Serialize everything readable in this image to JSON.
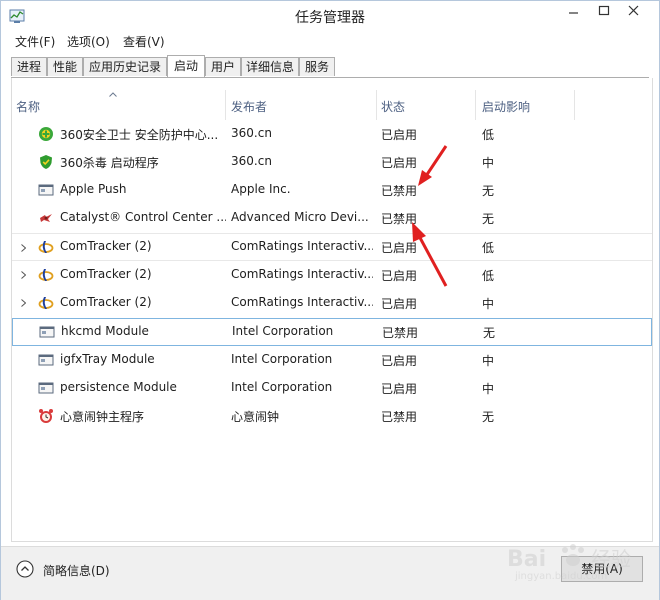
{
  "window": {
    "title": "任务管理器"
  },
  "menu": [
    {
      "label": "文件(F)"
    },
    {
      "label": "选项(O)"
    },
    {
      "label": "查看(V)"
    }
  ],
  "tabs": [
    {
      "label": "进程"
    },
    {
      "label": "性能"
    },
    {
      "label": "应用历史记录"
    },
    {
      "label": "启动",
      "active": true
    },
    {
      "label": "用户"
    },
    {
      "label": "详细信息"
    },
    {
      "label": "服务"
    }
  ],
  "columns": {
    "name": "名称",
    "publisher": "发布者",
    "status": "状态",
    "impact": "启动影响"
  },
  "rows": [
    {
      "name": "360安全卫士 安全防护中心...",
      "publisher": "360.cn",
      "status": "已启用",
      "impact": "低",
      "icon": "360-safe-icon"
    },
    {
      "name": "360杀毒 启动程序",
      "publisher": "360.cn",
      "status": "已启用",
      "impact": "中",
      "icon": "360-antivirus-icon"
    },
    {
      "name": "Apple Push",
      "publisher": "Apple Inc.",
      "status": "已禁用",
      "impact": "无",
      "icon": "program-icon"
    },
    {
      "name": "Catalyst® Control Center ...",
      "publisher": "Advanced Micro Devi...",
      "status": "已禁用",
      "impact": "无",
      "icon": "amd-catalyst-icon"
    },
    {
      "name": "ComTracker (2)",
      "publisher": "ComRatings Interactiv...",
      "status": "已启用",
      "impact": "低",
      "icon": "comtracker-icon",
      "expandable": true
    },
    {
      "name": "ComTracker (2)",
      "publisher": "ComRatings Interactiv...",
      "status": "已启用",
      "impact": "低",
      "icon": "comtracker-icon",
      "expandable": true
    },
    {
      "name": "ComTracker (2)",
      "publisher": "ComRatings Interactiv...",
      "status": "已启用",
      "impact": "中",
      "icon": "comtracker-icon",
      "expandable": true
    },
    {
      "name": "hkcmd Module",
      "publisher": "Intel Corporation",
      "status": "已禁用",
      "impact": "无",
      "icon": "program-icon",
      "selected": true
    },
    {
      "name": "igfxTray Module",
      "publisher": "Intel Corporation",
      "status": "已启用",
      "impact": "中",
      "icon": "program-icon"
    },
    {
      "name": "persistence Module",
      "publisher": "Intel Corporation",
      "status": "已启用",
      "impact": "中",
      "icon": "program-icon"
    },
    {
      "name": "心意闹钟主程序",
      "publisher": "心意闹钟",
      "status": "已禁用",
      "impact": "无",
      "icon": "alarm-clock-icon"
    }
  ],
  "footer": {
    "fewer_details": "简略信息(D)",
    "disable_button": "禁用(A)"
  },
  "watermark": {
    "text": "Bai",
    "text2": "经验",
    "url": "jingyan.baidu.com"
  },
  "colors": {
    "annotation_arrow": "#e02020",
    "selection_border": "#7fb5e0",
    "header_text": "#4d6082"
  }
}
